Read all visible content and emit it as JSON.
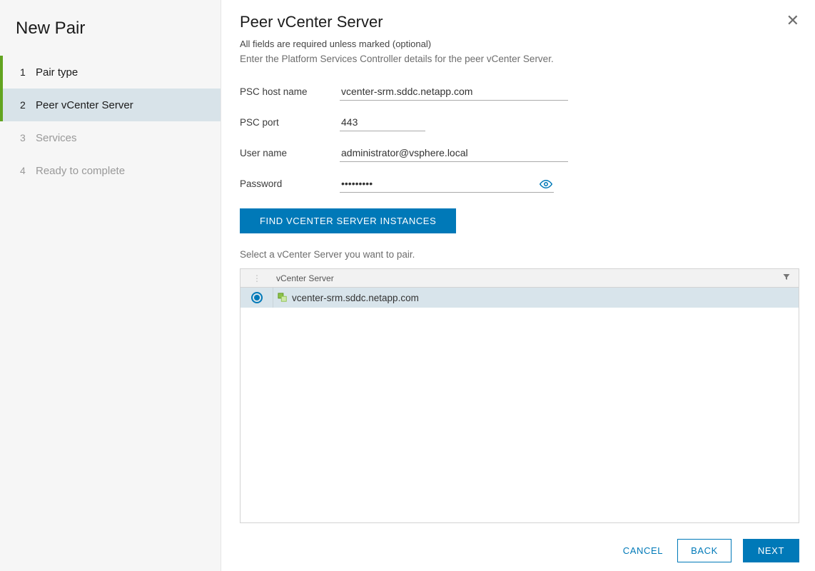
{
  "sidebar": {
    "title": "New Pair",
    "steps": [
      {
        "num": "1",
        "label": "Pair type"
      },
      {
        "num": "2",
        "label": "Peer vCenter Server"
      },
      {
        "num": "3",
        "label": "Services"
      },
      {
        "num": "4",
        "label": "Ready to complete"
      }
    ]
  },
  "main": {
    "title": "Peer vCenter Server",
    "required_note": "All fields are required unless marked (optional)",
    "instructions": "Enter the Platform Services Controller details for the peer vCenter Server.",
    "form": {
      "psc_host_label": "PSC host name",
      "psc_host_value": "vcenter-srm.sddc.netapp.com",
      "psc_port_label": "PSC port",
      "psc_port_value": "443",
      "user_label": "User name",
      "user_value": "administrator@vsphere.local",
      "password_label": "Password",
      "password_value": "•••••••••"
    },
    "find_button": "FIND VCENTER SERVER INSTANCES",
    "select_instruction": "Select a vCenter Server you want to pair.",
    "grid": {
      "header": "vCenter Server",
      "rows": [
        {
          "name": "vcenter-srm.sddc.netapp.com"
        }
      ]
    }
  },
  "footer": {
    "cancel": "CANCEL",
    "back": "BACK",
    "next": "NEXT"
  },
  "colors": {
    "accent_green": "#62a420",
    "accent_blue": "#0079b8"
  }
}
